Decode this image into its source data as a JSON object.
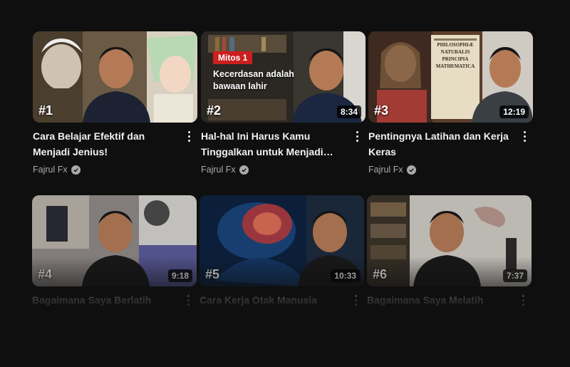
{
  "videos": [
    {
      "rank": "#1",
      "title": "Cara Belajar Efektif dan Menjadi Jenius!",
      "channel": "Fajrul Fx",
      "duration": ""
    },
    {
      "rank": "#2",
      "title": "Hal-hal Ini Harus Kamu Tinggalkan untuk Menjadi…",
      "channel": "Fajrul Fx",
      "duration": "8:34",
      "badge": "Mitos 1",
      "overlay": "Kecerdasan adalah bawaan lahir"
    },
    {
      "rank": "#3",
      "title": "Pentingnya Latihan dan Kerja Keras",
      "channel": "Fajrul Fx",
      "duration": "12:19",
      "book_text": "PHILOSOPHIÆ NATURALIS PRINCIPIA MATHEMATICA"
    },
    {
      "rank": "#4",
      "title": "Bagaimana Saya Berlatih",
      "channel": "",
      "duration": "9:18"
    },
    {
      "rank": "#5",
      "title": "Cara Kerja Otak Manusia",
      "channel": "",
      "duration": "10:33"
    },
    {
      "rank": "#6",
      "title": "Bagaimana Saya Melatih",
      "channel": "",
      "duration": "7:37"
    }
  ],
  "icons": {
    "verified": "check-circle-icon",
    "more": "more-vert-icon"
  },
  "colors": {
    "background": "#0f0f0f",
    "badge_red": "#cc1f1f",
    "secondary_text": "#aaaaaa"
  }
}
